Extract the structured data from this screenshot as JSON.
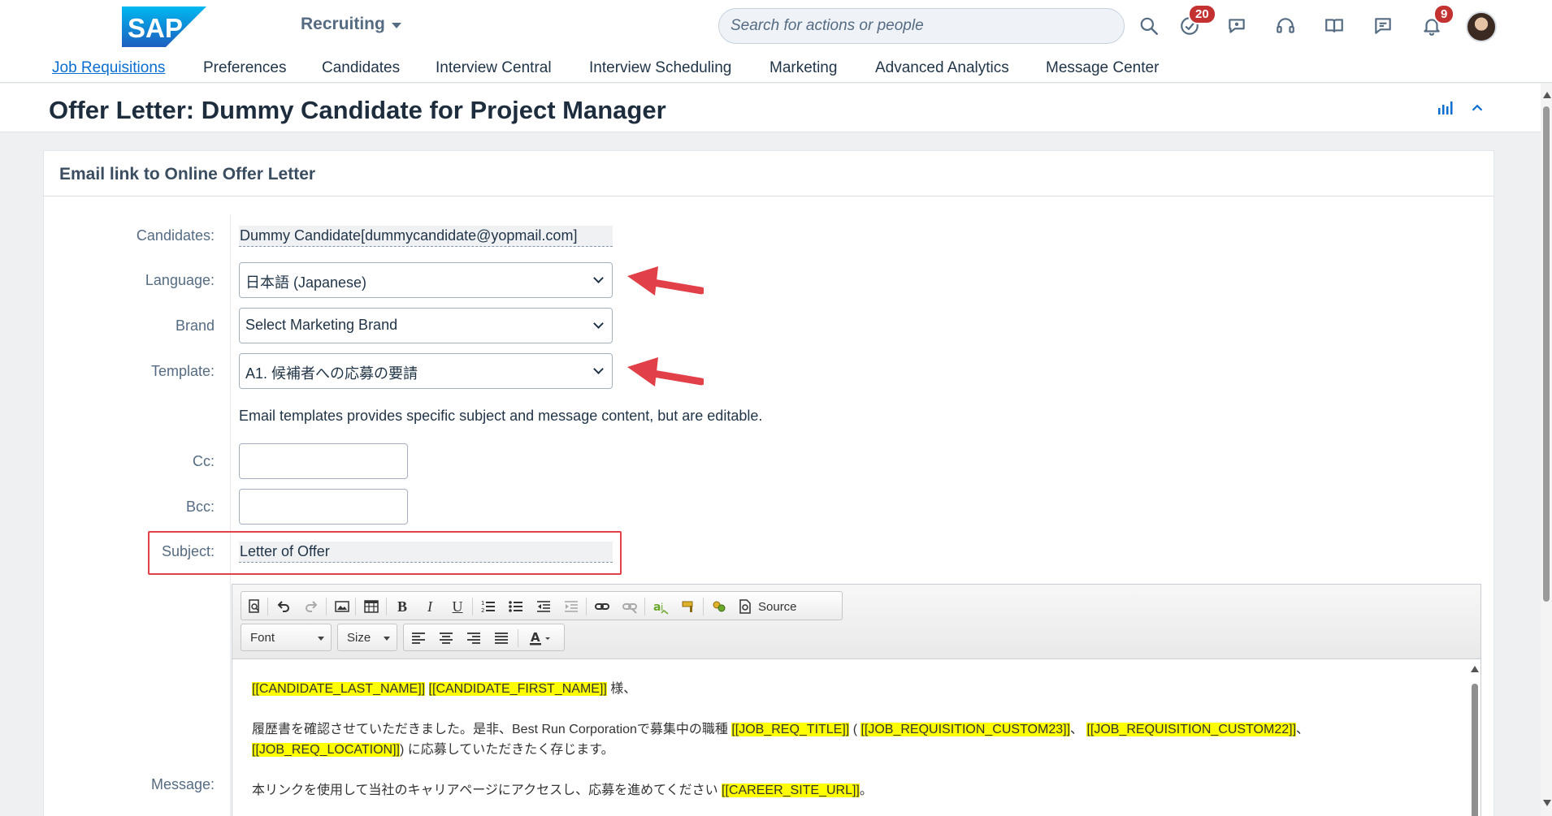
{
  "shell": {
    "product_menu": "Recruiting",
    "search_placeholder": "Search for actions or people",
    "todo_badge": "20",
    "notification_badge": "9"
  },
  "nav": {
    "items": [
      "Job Requisitions",
      "Preferences",
      "Candidates",
      "Interview Central",
      "Interview Scheduling",
      "Marketing",
      "Advanced Analytics",
      "Message Center"
    ],
    "active": "Job Requisitions"
  },
  "page": {
    "title": "Offer Letter: Dummy Candidate for Project Manager"
  },
  "form": {
    "card_title": "Email link to Online Offer Letter",
    "candidates_label": "Candidates:",
    "candidates_value": "Dummy Candidate[dummycandidate@yopmail.com]",
    "language_label": "Language:",
    "language_value": "日本語 (Japanese)",
    "brand_label": "Brand",
    "brand_value": "Select Marketing Brand",
    "template_label": "Template:",
    "template_value": "A1. 候補者への応募の要請",
    "template_note": "Email templates provides specific subject and message content, but are editable.",
    "cc_label": "Cc:",
    "bcc_label": "Bcc:",
    "subject_label": "Subject:",
    "subject_value": "Letter of Offer",
    "message_label": "Message:"
  },
  "editor": {
    "font_combo": "Font",
    "size_combo": "Size",
    "source_button": "Source",
    "body": {
      "line1_ph1": "[[CANDIDATE_LAST_NAME]]",
      "line1_ph2": "[[CANDIDATE_FIRST_NAME]]",
      "line1_suffix": " 様、",
      "line2_prefix": "履歴書を確認させていただきました。是非、Best Run Corporationで募集中の職種 ",
      "line2_ph1": "[[JOB_REQ_TITLE]]",
      "line2_sep1": " ( ",
      "line2_ph2": "[[JOB_REQUISITION_CUSTOM23]]",
      "line2_sep2": "、 ",
      "line2_ph3": "[[JOB_REQUISITION_CUSTOM22]]",
      "line2_sep3": "、",
      "line3_ph1": "[[JOB_REQ_LOCATION]]",
      "line3_suffix": ") に応募していただきたく存じます。",
      "line4_prefix": "本リンクを使用して当社のキャリアページにアクセスし、応募を進めてください ",
      "line4_ph1": "[[CAREER_SITE_URL]]",
      "line4_suffix": "。"
    }
  },
  "colors": {
    "sap_blue": "#0a6ed1",
    "badge_red": "#c33131",
    "annotation_red": "#e24048",
    "placeholder_highlight": "#ffff00"
  }
}
